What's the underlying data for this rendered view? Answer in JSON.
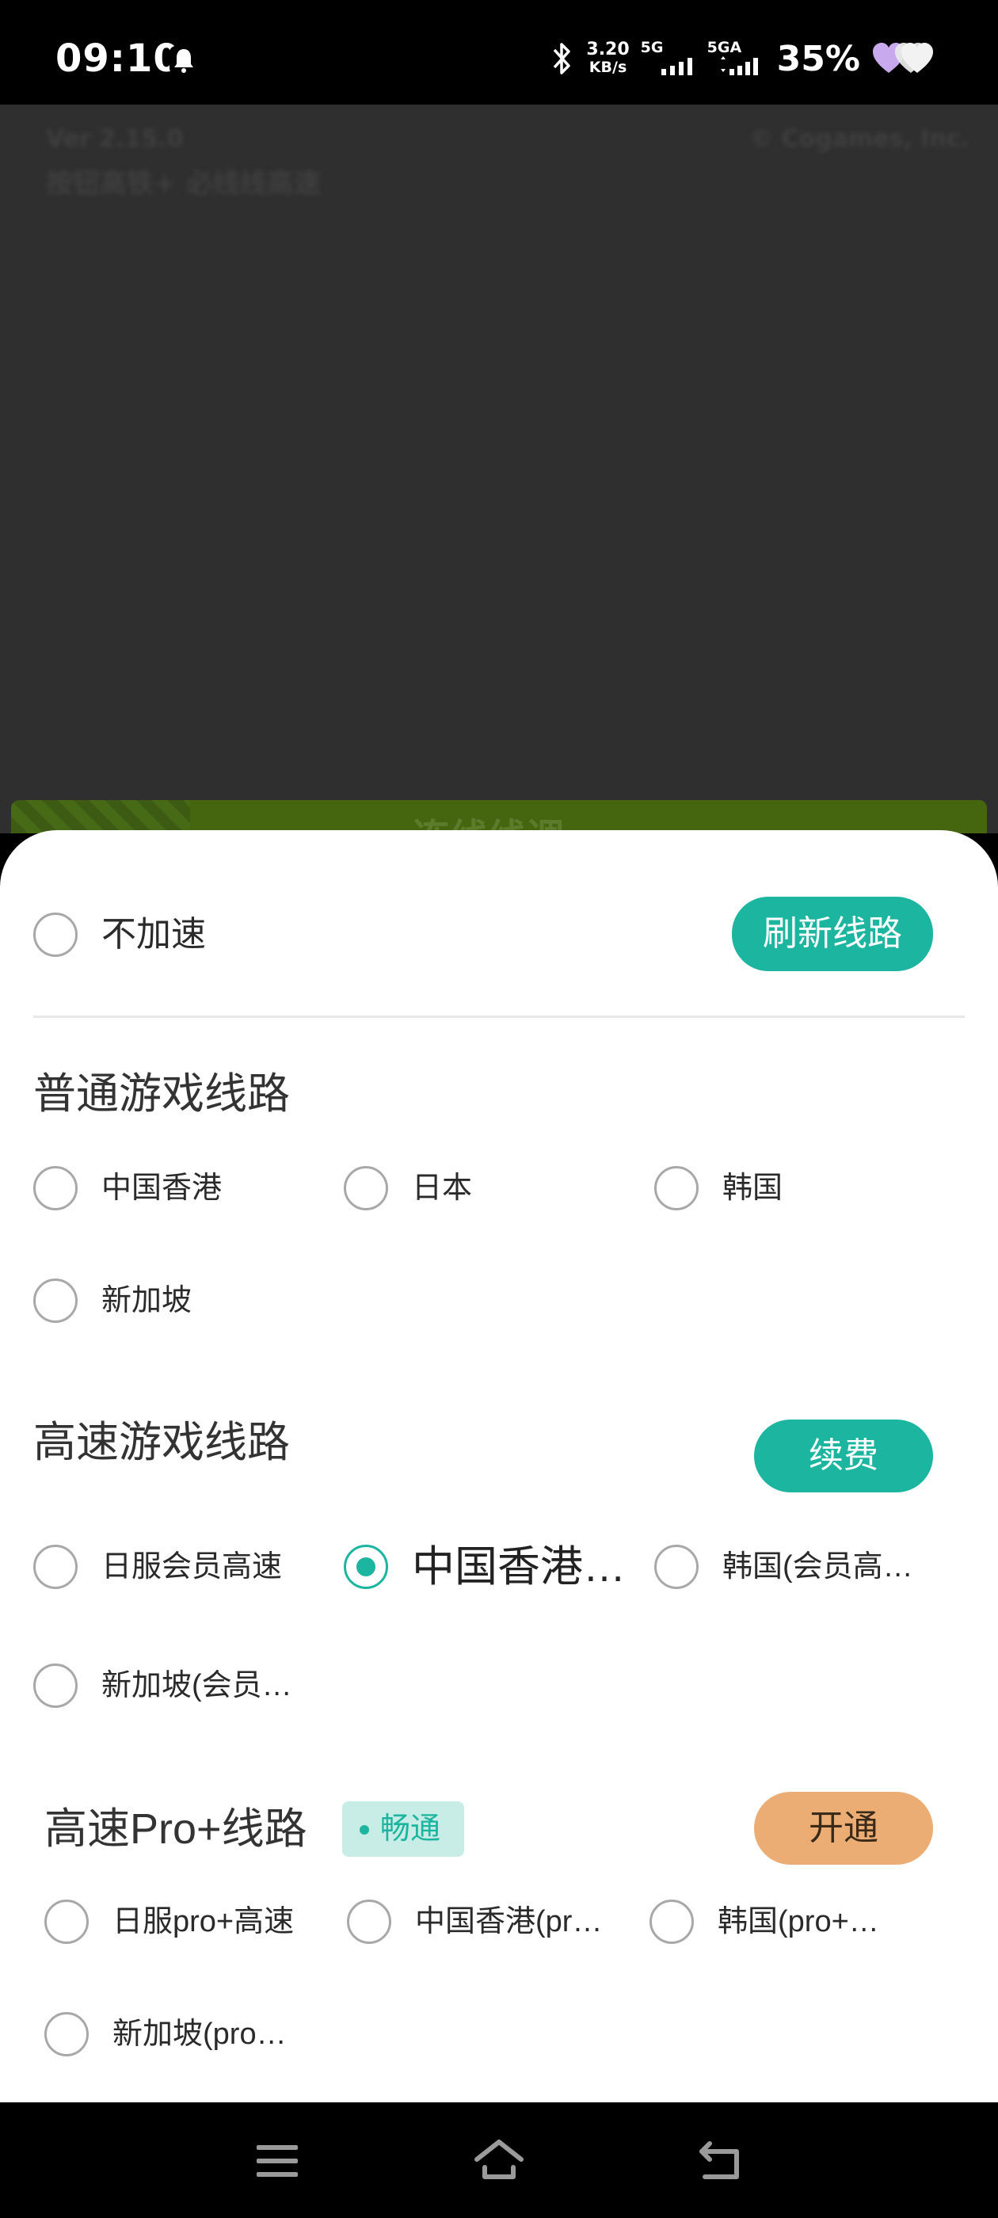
{
  "status_bar": {
    "time": "09:10",
    "net_speed_value": "3.20",
    "net_speed_unit": "KB/s",
    "sim1_label": "5G",
    "sim2_label": "5GA",
    "battery": "35%"
  },
  "background_app": {
    "version": "Ver 2.15.0",
    "subtitle": "按钮高铁+ 必线线高速",
    "copyright": "© Cogames, Inc.",
    "banner_text": "连线线调"
  },
  "sheet": {
    "no_accel_label": "不加速",
    "refresh_button": "刷新线路",
    "normal_section": {
      "title": "普通游戏线路",
      "options": [
        "中国香港",
        "日本",
        "韩国",
        "新加坡"
      ]
    },
    "fast_section": {
      "title": "高速游戏线路",
      "renew_button": "续费",
      "options": [
        "日服会员高速",
        "中国香港…",
        "韩国(会员高…",
        "新加坡(会员…"
      ],
      "selected_index": 1
    },
    "pro_section": {
      "title": "高速Pro+线路",
      "status_tag": "畅通",
      "open_button": "开通",
      "options": [
        "日服pro+高速",
        "中国香港(pr…",
        "韩国(pro+…",
        "新加坡(pro…"
      ]
    }
  },
  "colors": {
    "accent": "#1cb5a0",
    "open_button": "#ecad74",
    "status_tag_bg": "#c8ece6"
  },
  "icons": {
    "status": [
      "bell-icon",
      "bluetooth-icon",
      "signal-icon",
      "heart-battery-icon"
    ],
    "nav": [
      "menu-icon",
      "home-icon",
      "back-icon"
    ]
  }
}
